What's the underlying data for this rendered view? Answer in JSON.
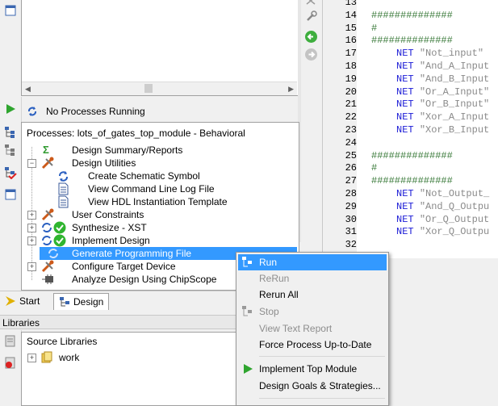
{
  "editor": {
    "lines": [
      {
        "n": "13",
        "code": ""
      },
      {
        "n": "14",
        "code": "##############"
      },
      {
        "n": "15",
        "code": "#"
      },
      {
        "n": "16",
        "code": "##############"
      },
      {
        "n": "17",
        "kw": "NET",
        "str": "\"Not_input\""
      },
      {
        "n": "18",
        "kw": "NET",
        "str": "\"And_A_Input"
      },
      {
        "n": "19",
        "kw": "NET",
        "str": "\"And_B_Input"
      },
      {
        "n": "20",
        "kw": "NET",
        "str": "\"Or_A_Input\""
      },
      {
        "n": "21",
        "kw": "NET",
        "str": "\"Or_B_Input\""
      },
      {
        "n": "22",
        "kw": "NET",
        "str": "\"Xor_A_Input"
      },
      {
        "n": "23",
        "kw": "NET",
        "str": "\"Xor_B_Input"
      },
      {
        "n": "24",
        "code": ""
      },
      {
        "n": "25",
        "code": "##############"
      },
      {
        "n": "26",
        "code": "#"
      },
      {
        "n": "27",
        "code": "##############"
      },
      {
        "n": "28",
        "kw": "NET",
        "str": "\"Not_Output_"
      },
      {
        "n": "29",
        "kw": "NET",
        "str": "\"And_Q_Outpu"
      },
      {
        "n": "30",
        "kw": "NET",
        "str": "\"Or_Q_Output"
      },
      {
        "n": "31",
        "kw": "NET",
        "str": "\"Xor_Q_Outpu"
      },
      {
        "n": "32",
        "code": ""
      }
    ]
  },
  "status": {
    "text": "No Processes Running"
  },
  "processes": {
    "title": "Processes: lots_of_gates_top_module - Behavioral",
    "items": [
      {
        "label": "Design Summary/Reports"
      },
      {
        "label": "Design Utilities"
      },
      {
        "label": "Create Schematic Symbol"
      },
      {
        "label": "View Command Line Log File"
      },
      {
        "label": "View HDL Instantiation Template"
      },
      {
        "label": "User Constraints"
      },
      {
        "label": "Synthesize - XST"
      },
      {
        "label": "Implement Design"
      },
      {
        "label": "Generate Programming File"
      },
      {
        "label": "Configure Target Device"
      },
      {
        "label": "Analyze Design Using ChipScope"
      }
    ]
  },
  "tabs": [
    {
      "label": "Start"
    },
    {
      "label": "Design"
    }
  ],
  "libraries": {
    "header": "Libraries",
    "title": "Source Libraries",
    "items": [
      {
        "label": "work"
      }
    ]
  },
  "context_menu": {
    "items": [
      {
        "label": "Run"
      },
      {
        "label": "ReRun"
      },
      {
        "label": "Rerun All"
      },
      {
        "label": "Stop"
      },
      {
        "label": "View Text Report"
      },
      {
        "label": "Force Process Up-to-Date"
      },
      {
        "label": "Implement Top Module"
      },
      {
        "label": "Design Goals & Strategies..."
      }
    ]
  },
  "colors": {
    "selection": "#3399ff",
    "comment": "#3a7a3a",
    "keyword": "#1b1bd6",
    "green_check": "#2fb52f"
  }
}
